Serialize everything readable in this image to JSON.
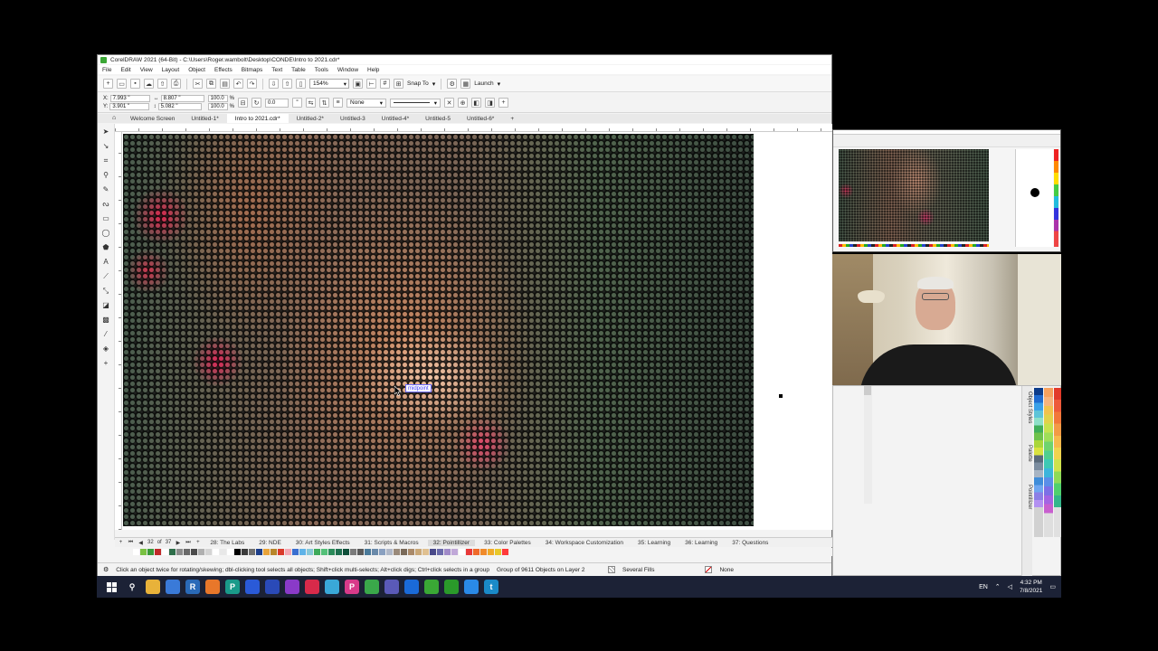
{
  "window": {
    "title": "CorelDRAW 2021 (64-Bit) - C:\\Users\\Roger.wambolt\\Desktop\\CONDE\\Intro to 2021.cdr*"
  },
  "menu": [
    "File",
    "Edit",
    "View",
    "Layout",
    "Object",
    "Effects",
    "Bitmaps",
    "Text",
    "Table",
    "Tools",
    "Window",
    "Help"
  ],
  "toolbar": {
    "zoom": "154%",
    "snap_to": "Snap To",
    "launch": "Launch"
  },
  "property_bar": {
    "x": "7.993 \"",
    "y": "3.901 \"",
    "width": "8.807 \"",
    "height": "5.082 \"",
    "scale_w": "100.0",
    "scale_h": "100.0",
    "percent": "%",
    "rotation": "0.0",
    "wrap": "None",
    "x_label": "X:",
    "y_label": "Y:"
  },
  "doc_tabs": [
    {
      "label": "Welcome Screen",
      "active": false
    },
    {
      "label": "Untitled-1*",
      "active": false
    },
    {
      "label": "Intro to 2021.cdr*",
      "active": true
    },
    {
      "label": "Untitled-2*",
      "active": false
    },
    {
      "label": "Untitled-3",
      "active": false
    },
    {
      "label": "Untitled-4*",
      "active": false
    },
    {
      "label": "Untitled-5",
      "active": false
    },
    {
      "label": "Untitled-6*",
      "active": false
    }
  ],
  "canvas": {
    "tooltip": "midpoint"
  },
  "page_nav": {
    "current": "32",
    "of": "of",
    "total": "37"
  },
  "page_tabs": [
    {
      "label": "28: The Labs",
      "active": false
    },
    {
      "label": "29: NDE",
      "active": false
    },
    {
      "label": "30: Art Styles Effects",
      "active": false
    },
    {
      "label": "31: Scripts & Macros",
      "active": false
    },
    {
      "label": "32: Pointillizer",
      "active": true
    },
    {
      "label": "33: Color Palettes",
      "active": false
    },
    {
      "label": "34: Workspace Customization",
      "active": false
    },
    {
      "label": "35: Learning",
      "active": false
    },
    {
      "label": "36: Learning",
      "active": false
    },
    {
      "label": "37: Questions",
      "active": false
    }
  ],
  "palette_colors": [
    "#ffffff",
    "#79c142",
    "#3a9a3a",
    "#c02a2a",
    "#ffffff",
    "#2e6e4a",
    "#8c8c8c",
    "#6a6a6a",
    "#4c4c4c",
    "#b0b0b0",
    "#d4d4d4",
    "#ffffff",
    "#e8e8e8",
    "#ffffff",
    "#000000",
    "#3b3b3b",
    "#707070",
    "#1d3f8a",
    "#e8a33a",
    "#b8862a",
    "#d93a2a",
    "#f5a8b5",
    "#3a6fd0",
    "#5fb3e8",
    "#88c8d8",
    "#3faa5a",
    "#53c078",
    "#2b8b5a",
    "#1e6f4f",
    "#0f4f3a",
    "#7a7a7a",
    "#5a5a5a",
    "#4a7a9a",
    "#6a8aaa",
    "#8aa0c0",
    "#b0b8c8",
    "#9a8a7a",
    "#7a6a5a",
    "#aa8a6a",
    "#caa878",
    "#e0c090",
    "#4a4a8a",
    "#6a6aaa",
    "#a08ac8",
    "#c0a8d8",
    "#ffffff",
    "#e83a3a",
    "#f06a2a",
    "#f08a2a",
    "#f0aa2a",
    "#e8c82a",
    "#ff3a3a"
  ],
  "status": {
    "hint": "Click an object twice for rotating/skewing; dbl-clicking tool selects all objects; Shift+click multi-selects; Alt+click digs; Ctrl+click selects in a group",
    "selection": "Group of 9611 Objects on Layer 2",
    "fill": "Several Fills",
    "outline": "None"
  },
  "docker": {
    "tab_object_styles": "Object Styles",
    "tab_palette": "Palette",
    "tab_pointillizer": "Pointillizer"
  },
  "taskbar": {
    "apps": [
      {
        "name": "file-explorer-icon",
        "color": "#e8b23a",
        "glyph": ""
      },
      {
        "name": "chrome-old-icon",
        "color": "#3a7ad8",
        "glyph": ""
      },
      {
        "name": "app-r-icon",
        "color": "#2a6ab8",
        "glyph": "R"
      },
      {
        "name": "vlc-icon",
        "color": "#e8772a",
        "glyph": ""
      },
      {
        "name": "app-p-icon",
        "color": "#1a9a8a",
        "glyph": "P"
      },
      {
        "name": "app-i-icon",
        "color": "#2a5ad8",
        "glyph": ""
      },
      {
        "name": "powershell-icon",
        "color": "#2a4ab8",
        "glyph": ""
      },
      {
        "name": "app-purple-icon",
        "color": "#8a3ac8",
        "glyph": ""
      },
      {
        "name": "app-red-icon",
        "color": "#d82a4a",
        "glyph": ""
      },
      {
        "name": "app-pinwheel-icon",
        "color": "#3aa8d8",
        "glyph": ""
      },
      {
        "name": "app-pink-p-icon",
        "color": "#d83a8a",
        "glyph": "P"
      },
      {
        "name": "chrome-icon",
        "color": "#3aa84a",
        "glyph": ""
      },
      {
        "name": "teams-icon",
        "color": "#5a5ab8",
        "glyph": ""
      },
      {
        "name": "outlook-icon",
        "color": "#1a6ad8",
        "glyph": ""
      },
      {
        "name": "coreldraw-icon",
        "color": "#3aa835",
        "glyph": ""
      },
      {
        "name": "coreldraw-active-icon",
        "color": "#2a9a2a",
        "glyph": ""
      },
      {
        "name": "zoom-icon",
        "color": "#2a8ae8",
        "glyph": ""
      },
      {
        "name": "app-t-icon",
        "color": "#1a8ac8",
        "glyph": "t"
      }
    ],
    "lang": "EN",
    "time": "4:32 PM",
    "date": "7/8/2021"
  }
}
